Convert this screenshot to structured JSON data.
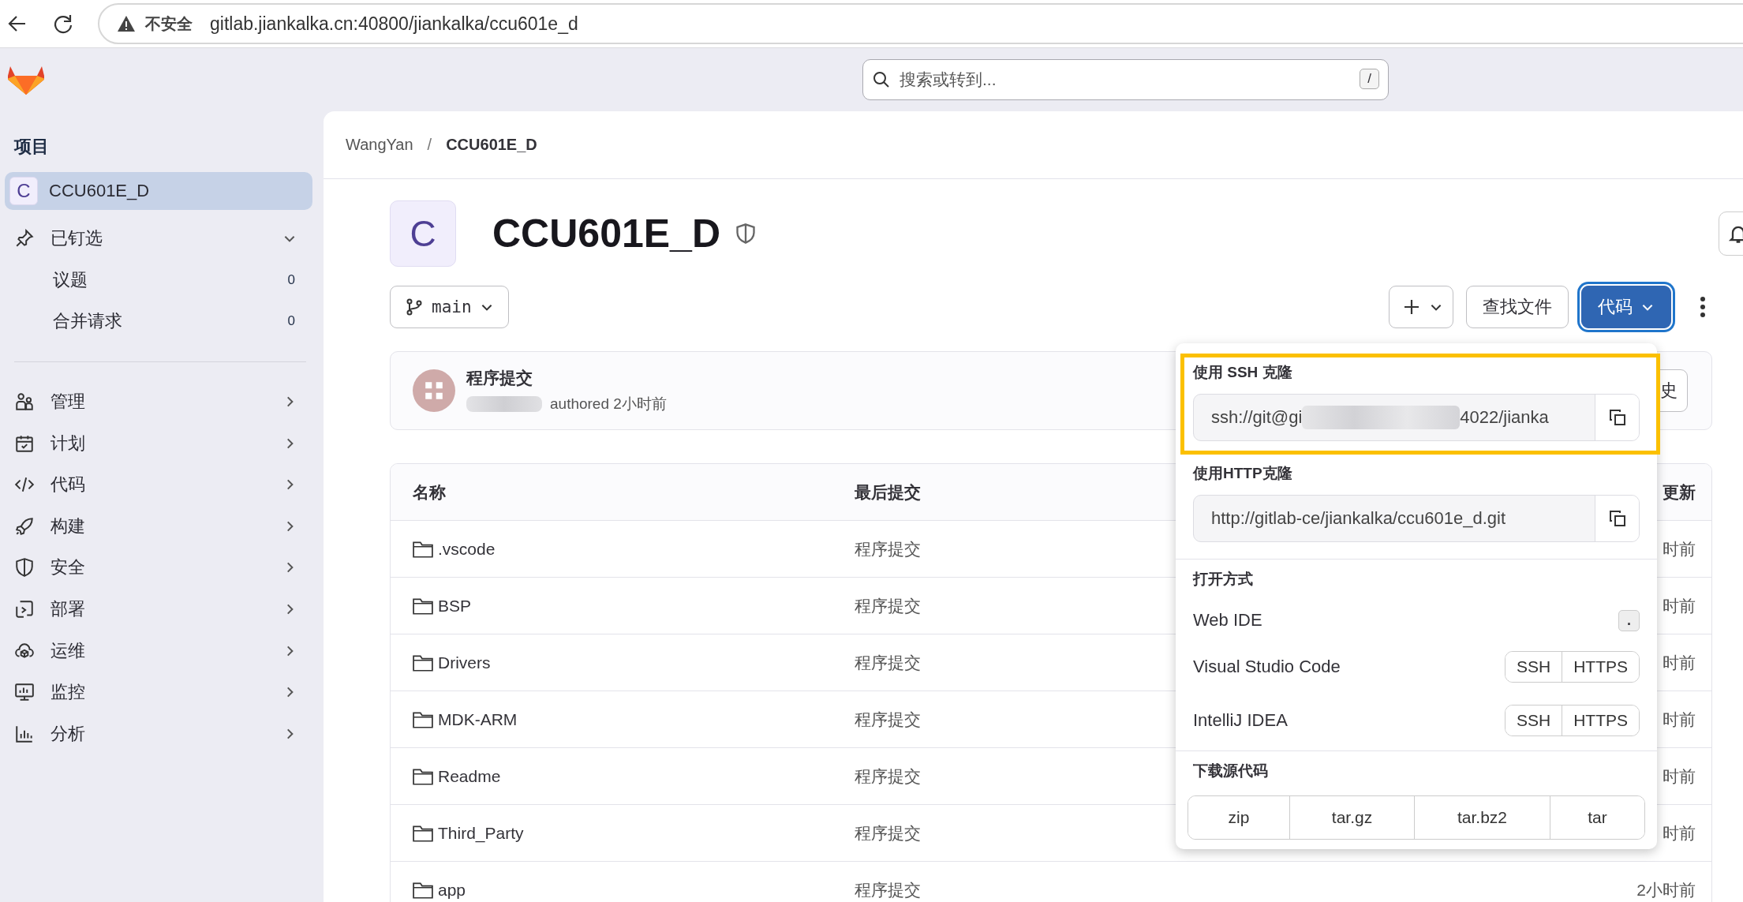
{
  "browser": {
    "security_label": "不安全",
    "url": "gitlab.jiankalka.cn:40800/jiankalka/ccu601e_d"
  },
  "search": {
    "placeholder": "搜索或转到...",
    "shortcut": "/"
  },
  "sidebar": {
    "heading": "项目",
    "project": {
      "avatar": "C",
      "name": "CCU601E_D",
      "selected": true
    },
    "pinned": {
      "label": "已钉选",
      "expanded": true,
      "items": [
        {
          "label": "议题",
          "count": "0"
        },
        {
          "label": "合并请求",
          "count": "0"
        }
      ]
    },
    "items": [
      {
        "label": "管理"
      },
      {
        "label": "计划"
      },
      {
        "label": "代码"
      },
      {
        "label": "构建"
      },
      {
        "label": "安全"
      },
      {
        "label": "部署"
      },
      {
        "label": "运维"
      },
      {
        "label": "监控"
      },
      {
        "label": "分析"
      }
    ]
  },
  "breadcrumb": {
    "separator": "/",
    "items": [
      {
        "label": "WangYan",
        "current": false
      },
      {
        "label": "CCU601E_D",
        "current": true
      }
    ]
  },
  "project": {
    "avatar": "C",
    "title": "CCU601E_D"
  },
  "branch": "main",
  "actions": {
    "find_file": "查找文件",
    "code": "代码",
    "code_expanded": true
  },
  "commit": {
    "title": "程序提交",
    "meta": "authored 2小时前",
    "history_button": "史"
  },
  "table": {
    "columns": [
      "名称",
      "最后提交",
      "更新"
    ],
    "rows": [
      {
        "name": ".vscode",
        "commit": "程序提交",
        "updated": "时前"
      },
      {
        "name": "BSP",
        "commit": "程序提交",
        "updated": "时前"
      },
      {
        "name": "Drivers",
        "commit": "程序提交",
        "updated": "时前"
      },
      {
        "name": "MDK-ARM",
        "commit": "程序提交",
        "updated": "时前"
      },
      {
        "name": "Readme",
        "commit": "程序提交",
        "updated": "时前"
      },
      {
        "name": "Third_Party",
        "commit": "程序提交",
        "updated": "时前"
      },
      {
        "name": "app",
        "commit": "程序提交",
        "updated": "2小时前"
      }
    ]
  },
  "clone_menu": {
    "clone_options": [
      {
        "label": "使用 SSH 克隆",
        "url": "ssh://git@gi",
        "url_tail": "4022/jianka",
        "highlighted": true
      },
      {
        "label": "使用HTTP克隆",
        "url": "http://gitlab-ce/jiankalka/ccu601e_d.git",
        "highlighted": false
      }
    ],
    "open_with": {
      "label": "打开方式",
      "options": [
        {
          "kind": "shortcut",
          "label": "Web IDE",
          "keys": [
            "."
          ]
        },
        {
          "kind": "protocols",
          "label": "Visual Studio Code",
          "buttons": [
            "SSH",
            "HTTPS"
          ]
        },
        {
          "kind": "protocols",
          "label": "IntelliJ IDEA",
          "buttons": [
            "SSH",
            "HTTPS"
          ]
        }
      ]
    },
    "download": {
      "label": "下载源代码",
      "formats": [
        "zip",
        "tar.gz",
        "tar.bz2",
        "tar"
      ]
    }
  }
}
